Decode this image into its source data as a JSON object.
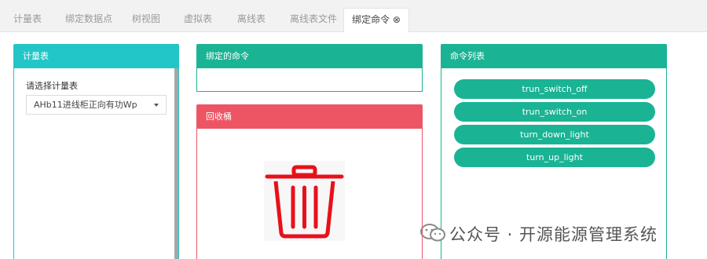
{
  "tabs": [
    {
      "label": "计量表",
      "active": false
    },
    {
      "label": "绑定数据点",
      "active": false
    },
    {
      "label": "树视图",
      "active": false
    },
    {
      "label": "虚拟表",
      "active": false
    },
    {
      "label": "离线表",
      "active": false
    },
    {
      "label": "离线表文件",
      "active": false
    },
    {
      "label": "绑定命令 ⊗",
      "active": true
    }
  ],
  "meter_panel": {
    "title": "计量表",
    "select_label": "请选择计量表",
    "select_value": "AHb11进线柜正向有功Wp"
  },
  "bound_panel": {
    "title": "绑定的命令"
  },
  "bin_panel": {
    "title": "回收桶"
  },
  "commands_panel": {
    "title": "命令列表",
    "commands": [
      "trun_switch_off",
      "trun_switch_on",
      "turn_down_light",
      "turn_up_light"
    ]
  },
  "watermark": {
    "text": "公众号 · 开源能源管理系统"
  },
  "colors": {
    "teal": "#23c6c8",
    "green": "#1ab394",
    "red": "#ed5565",
    "trash": "#e8101a"
  }
}
